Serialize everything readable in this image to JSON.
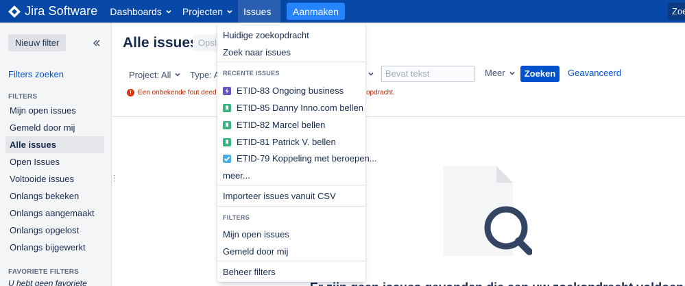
{
  "nav": {
    "logo": "Jira Software",
    "items": [
      {
        "label": "Dashboards"
      },
      {
        "label": "Projecten"
      },
      {
        "label": "Issues"
      }
    ],
    "create": "Aanmaken",
    "search_placeholder": "Zoe"
  },
  "sidebar": {
    "new_filter": "Nieuw filter",
    "find_filters": "Filters zoeken",
    "filters_title": "FILTERS",
    "items": [
      {
        "label": "Mijn open issues"
      },
      {
        "label": "Gemeld door mij"
      },
      {
        "label": "Alle issues"
      },
      {
        "label": "Open Issues"
      },
      {
        "label": "Voltooide issues"
      },
      {
        "label": "Onlangs bekeken"
      },
      {
        "label": "Onlangs aangemaakt"
      },
      {
        "label": "Onlangs opgelost"
      },
      {
        "label": "Onlangs bijgewerkt"
      }
    ],
    "favorites_title": "FAVORIETE FILTERS",
    "no_favorites": "U hebt geen favoriete"
  },
  "main": {
    "title": "Alle issues",
    "save_as": "Opsla",
    "project_filter": "Project: All",
    "type_filter": "Type: Al",
    "text_placeholder": "Bevat tekst",
    "more": "Meer",
    "search": "Zoeken",
    "advanced": "Geavanceerd",
    "error_start": "Een onbekende fout deed zi",
    "error_end": "opdracht.",
    "empty_text": "Er zijn geen issues gevonden die aan uw zoekopdracht voldoen"
  },
  "dropdown": {
    "current_search": "Huidige zoekopdracht",
    "search_issues": "Zoek naar issues",
    "recent_title": "RECENTE ISSUES",
    "recent": [
      {
        "type": "epic",
        "label": "ETID-83 Ongoing business"
      },
      {
        "type": "story",
        "label": "ETID-85 Danny Inno.com bellen"
      },
      {
        "type": "story",
        "label": "ETID-82 Marcel bellen"
      },
      {
        "type": "story",
        "label": "ETID-81 Patrick V. bellen"
      },
      {
        "type": "task",
        "label": "ETID-79 Koppeling met beroepen..."
      }
    ],
    "more": "meer...",
    "import_csv": "Importeer issues vanuit CSV",
    "filters_title": "FILTERS",
    "filters": [
      {
        "label": "Mijn open issues"
      },
      {
        "label": "Gemeld door mij"
      }
    ],
    "manage": "Beheer filters"
  },
  "colors": {
    "nav_bg": "#0747a6",
    "accent": "#0052cc",
    "error": "#de350b"
  }
}
